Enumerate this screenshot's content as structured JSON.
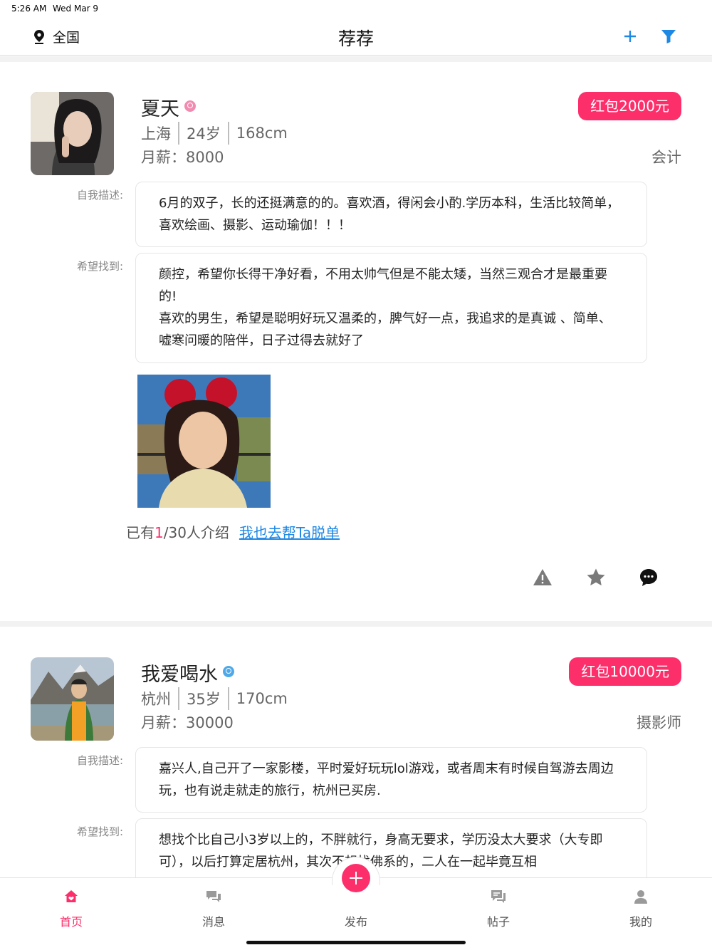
{
  "status_bar": {
    "time": "5:26 AM",
    "date": "Wed Mar 9"
  },
  "nav": {
    "location": "全国",
    "title": "荐荐"
  },
  "colors": {
    "accent": "#fc2f6b",
    "link": "#1e88e5",
    "female": "#f28bb0",
    "male": "#4fa9e8"
  },
  "cards": [
    {
      "name": "夏天",
      "gender": "female",
      "city": "上海",
      "age": "24岁",
      "height": "168cm",
      "salary": "月薪：8000",
      "red_packet": "红包2000元",
      "job": "会计",
      "desc_label": "自我描述:",
      "desc": "6月的双子，长的还挺满意的的。喜欢酒，得闲会小酌.学历本科，生活比较简单，喜欢绘画、摄影、运动瑜伽！！！",
      "want_label": "希望找到:",
      "want": "颜控，希望你长得干净好看，不用太帅气但是不能太矮，当然三观合才是最重要的!\n喜欢的男生，希望是聪明好玩又温柔的，脾气好一点，我追求的是真诚 、简单、嘘寒问暖的陪伴，日子过得去就好了",
      "intro_prefix": "已有",
      "intro_count": "1",
      "intro_suffix": "/30人介绍",
      "intro_link": "我也去帮Ta脱单",
      "actions": [
        "report-icon",
        "star-icon",
        "chat-icon"
      ]
    },
    {
      "name": "我爱喝水",
      "gender": "male",
      "city": "杭州",
      "age": "35岁",
      "height": "170cm",
      "salary": "月薪：30000",
      "red_packet": "红包10000元",
      "job": "摄影师",
      "desc_label": "自我描述:",
      "desc": "嘉兴人,自己开了一家影楼，平时爱好玩玩lol游戏，或者周末有时候自驾游去周边玩，也有说走就走的旅行，杭州已买房.",
      "want_label": "希望找到:",
      "want": "想找个比自己小3岁以上的，不胖就行，身高无要求，学历没太大要求（大专即可），以后打算定居杭州，其次不想找佛系的，二人在一起毕竟互相"
    }
  ],
  "tabs": [
    {
      "label": "首页",
      "icon": "home-icon"
    },
    {
      "label": "消息",
      "icon": "message-icon"
    },
    {
      "label": "发布",
      "icon": "publish-plus-icon"
    },
    {
      "label": "帖子",
      "icon": "posts-icon"
    },
    {
      "label": "我的",
      "icon": "profile-icon"
    }
  ]
}
